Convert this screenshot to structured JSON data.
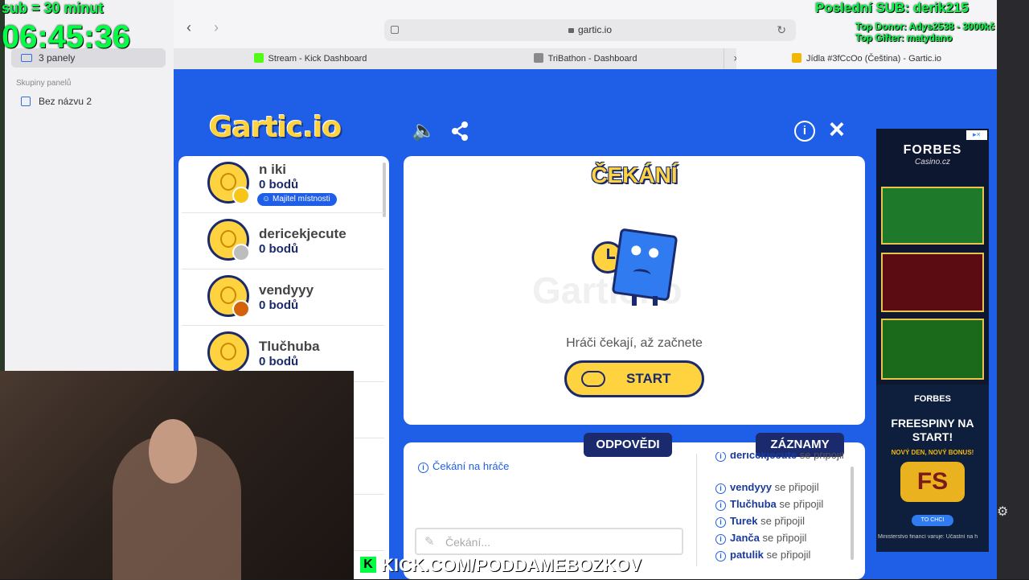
{
  "overlay": {
    "sub_line": "sub = 30 minut",
    "timer": "06:45:36",
    "last_sub": "Poslední SUB: derik215",
    "top_donor": "Top Donor: Adys2538 - 3000kč",
    "top_gifter": "Top Gifter: matydano",
    "kick_url": "KICK.COM/PODDAMEBOZKOV"
  },
  "browser": {
    "sidebar_panels": "3 panely",
    "sidebar_group_header": "Skupiny panelů",
    "sidebar_group_item": "Bez názvu 2",
    "url": "gartic.io",
    "tabs": [
      {
        "label": "Stream - Kick Dashboard",
        "color": "#53fc18"
      },
      {
        "label": "TriBathon - Dashboard",
        "color": "#8a8a8a"
      },
      {
        "label": "Jídla #3fCcOo (Čeština) - Gartic.io",
        "color": "#f2b705"
      }
    ]
  },
  "game": {
    "logo": "Gartic.io",
    "players": [
      {
        "name": "n iki",
        "points": "0 bodů",
        "badge": "Majitel místnosti",
        "dot_color": "#f5c518"
      },
      {
        "name": "dericekjecute",
        "points": "0 bodů",
        "dot_color": "#bdbdbd"
      },
      {
        "name": "vendyyy",
        "points": "0 bodů",
        "dot_color": "#d4620a"
      },
      {
        "name": "Tlučhuba",
        "points": "0 bodů",
        "dot_color": "#ffffff"
      }
    ],
    "waiting_title": "ČEKÁNÍ",
    "watermark": "Gartic.io",
    "waiting_text": "Hráči čekají, až začnete",
    "start_label": "START",
    "answers_tab": "ODPOVĚDI",
    "records_tab": "ZÁZNAMY",
    "answers_log": "Čekání na hráče",
    "answer_placeholder": "Čekání...",
    "records_log": [
      {
        "name": "dericekjecute",
        "text": "se připojil"
      },
      {
        "name": "vendyyy",
        "text": "se připojil"
      },
      {
        "name": "Tlučhuba",
        "text": "se připojil"
      },
      {
        "name": "Turek",
        "text": "se připojil"
      },
      {
        "name": "Janča",
        "text": "se připojil"
      },
      {
        "name": "patulik",
        "text": "se připojil"
      }
    ]
  },
  "ad": {
    "brand": "FORBES",
    "brand_sub": "Casino.cz",
    "headline": "FREESPINY NA START!",
    "subline": "NOVÝ DEN, NOVÝ BONUS!",
    "logo_text": "FS",
    "cta": "TO CHCI",
    "disclaimer": "Ministerstvo financí varuje: Účastní na h"
  }
}
